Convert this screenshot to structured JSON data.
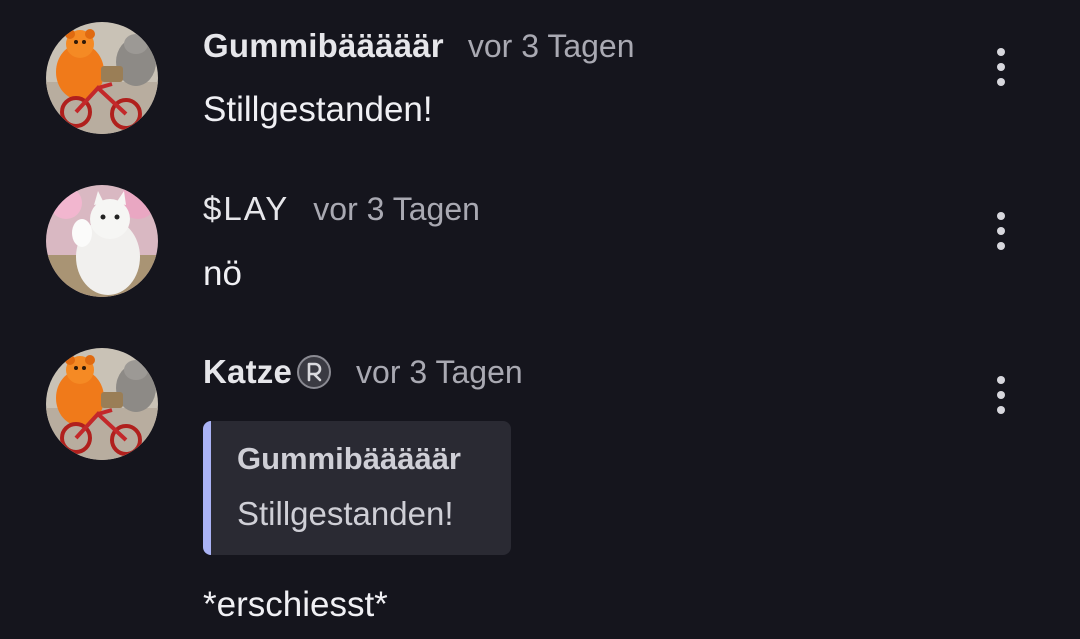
{
  "comments": [
    {
      "author": "Gummibääääär",
      "time": "vor 3 Tagen",
      "text": "Stillgestanden!",
      "avatar_icon": "orange-bear-on-bicycle-with-cat-avatar"
    },
    {
      "author": "$LAY",
      "time": "vor 3 Tagen",
      "text": "nö",
      "avatar_icon": "white-cat-waving-avatar"
    },
    {
      "author": "Katze",
      "badge_icon": "registered-icon",
      "time": "vor 3 Tagen",
      "quote": {
        "author": "Gummibääääär",
        "text": "Stillgestanden!"
      },
      "text": "*erschiesst*",
      "avatar_icon": "orange-bear-on-bicycle-with-cat-avatar"
    }
  ],
  "menu_icon": "more-vertical-icon",
  "colors": {
    "background": "#15151d",
    "quote_accent": "#aab3f5",
    "quote_background": "#2a2a33",
    "timestamp": "#a9a9b2"
  }
}
